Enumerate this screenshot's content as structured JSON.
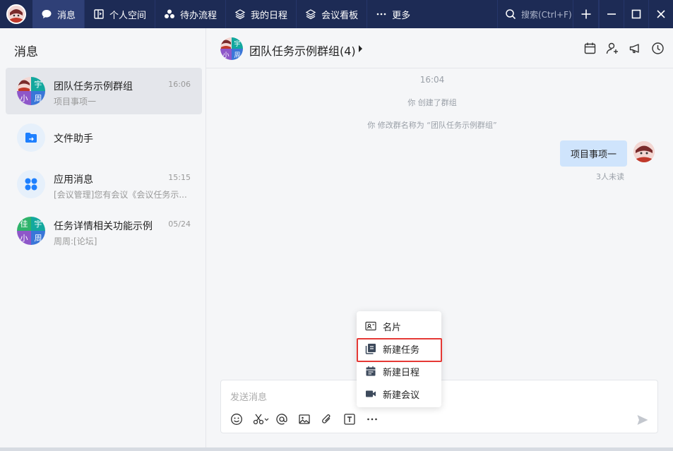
{
  "nav": {
    "tabs": [
      {
        "label": "消息",
        "icon": "chat-bubble-icon",
        "active": true
      },
      {
        "label": "个人空间",
        "icon": "book-icon"
      },
      {
        "label": "待办流程",
        "icon": "workflow-icon"
      },
      {
        "label": "我的日程",
        "icon": "layers-icon"
      },
      {
        "label": "会议看板",
        "icon": "layers-icon"
      },
      {
        "label": "更多",
        "icon": "more-icon"
      }
    ],
    "search_placeholder": "搜索(Ctrl+F)"
  },
  "sidebar": {
    "title": "消息",
    "conversations": [
      {
        "name": "团队任务示例群组",
        "time": "16:06",
        "preview": "项目事项一",
        "avatar": [
          "",
          "宇",
          "小",
          "周"
        ]
      },
      {
        "name": "文件助手",
        "time": "",
        "preview": "",
        "avatar_icon": "folder-icon"
      },
      {
        "name": "应用消息",
        "time": "15:15",
        "preview": "[会议管理]您有会议《会议任务示...",
        "avatar_icon": "apps-grid-icon"
      },
      {
        "name": "任务详情相关功能示例",
        "time": "05/24",
        "preview": "周周:[论坛]",
        "avatar": [
          "佳",
          "宇",
          "小",
          "周"
        ]
      }
    ]
  },
  "chat": {
    "title": "团队任务示例群组(4)",
    "group_avatar": [
      "",
      "宇",
      "小",
      "周"
    ],
    "system_messages": [
      "16:04",
      "你 创建了群组",
      "你 修改群名称为 “团队任务示例群组”"
    ],
    "message": {
      "text": "项目事项一",
      "status": "3人未读"
    },
    "input_placeholder": "发送消息",
    "popup_menu": [
      {
        "label": "名片",
        "icon": "contact-card-icon"
      },
      {
        "label": "新建任务",
        "icon": "task-icon",
        "highlighted": true
      },
      {
        "label": "新建日程",
        "icon": "calendar-icon"
      },
      {
        "label": "新建会议",
        "icon": "video-icon"
      }
    ]
  },
  "colors": {
    "topbar": "#1d2b55",
    "accent_blue": "#1e80ff",
    "bubble": "#cfe4fc",
    "highlight_border": "#e53935"
  }
}
